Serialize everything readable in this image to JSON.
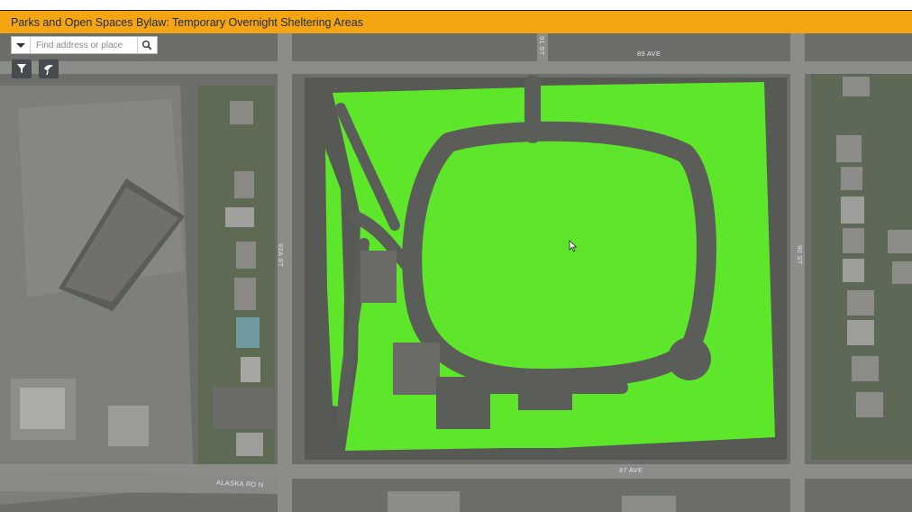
{
  "app": {
    "title": "Parks and Open Spaces Bylaw: Temporary Overnight Sheltering Areas"
  },
  "search": {
    "placeholder": "Find address or place"
  },
  "icons": {
    "dropdown": "chevron-down-icon",
    "search": "search-icon",
    "filter": "filter-icon",
    "layers": "layer-icon"
  },
  "map": {
    "streets": {
      "ave_top": "89 AVE",
      "ave_bottom": "87 AVE",
      "st_left": "92A ST",
      "st_right": "90 ST",
      "st_top": "91 ST",
      "road_bottom_left": "ALASKA RD N"
    },
    "highlight_color": "#5ee62a"
  },
  "colors": {
    "title_bar": "#f4a511",
    "tool_button": "#454b4e"
  }
}
